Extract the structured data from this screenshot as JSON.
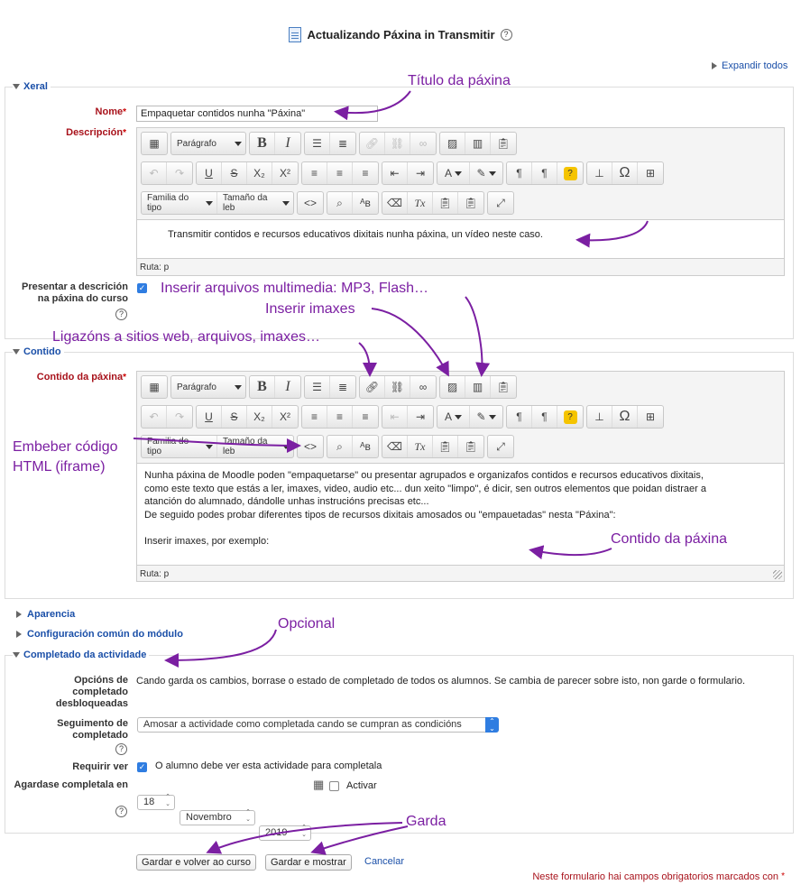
{
  "header": {
    "title": "Actualizando Páxina in Transmitir",
    "help": "?"
  },
  "expand_all": "Expandir todos",
  "xeral": {
    "legend": "Xeral",
    "name_label": "Nome",
    "name_value": "Empaquetar contidos nunha \"Páxina\"",
    "description_label": "Descripción",
    "description_text": "Transmitir contidos e recursos educativos dixitais nunha páxina, un vídeo neste caso.",
    "path": "Ruta: p",
    "show_desc_label": "Presentar a descrición na páxina do curso"
  },
  "toolbar": {
    "paragraph": "Parágrafo",
    "font_family": "Familia do tipo",
    "font_size": "Tamaño da leb",
    "bold": "B",
    "italic": "I",
    "sub": "X₂",
    "sup": "X²",
    "omega": "Ω",
    "textcolor": "A",
    "clear": "Tx",
    "source": "<>",
    "help": "?"
  },
  "contido": {
    "legend": "Contido",
    "label": "Contido da páxina",
    "lines": [
      "Nunha páxina de Moodle poden \"empaquetarse\" ou presentar agrupados e organizafos contidos e recursos educativos dixitais,",
      "como este texto que estás a ler, imaxes, video, audio etc... dun xeito \"limpo\", é dicir, sen outros elementos que poidan distraer a",
      "atanción do alumnado, dándolle unhas instrucións precisas etc...",
      "De seguido podes probar diferentes tipos de recursos dixitais amosados ou \"empauetadas\" nesta \"Páxina\":",
      "",
      "Inserir imaxes, por exemplo:"
    ],
    "path": "Ruta: p"
  },
  "sections": {
    "aparencia": "Aparencia",
    "config": "Configuración común do módulo",
    "completado": "Completado da actividade"
  },
  "completion": {
    "unlocked_label": "Opcións de completado desbloqueadas",
    "unlocked_text": "Cando garda os cambios, borrase o estado de completado de todos os alumnos. Se cambia de parecer sobre isto, non garde o formulario.",
    "tracking_label": "Seguimento de completado",
    "tracking_value": "Amosar a actividade como completada cando se cumpran as condicións",
    "require_view_label": "Requirir ver",
    "require_view_text": "O alumno debe ver esta actividade para completala",
    "expected_label": "Agardase completala en",
    "day": "18",
    "month": "Novembro",
    "year": "2019",
    "enable": "Activar"
  },
  "buttons": {
    "save_return": "Gardar e volver ao curso",
    "save_show": "Gardar e mostrar",
    "cancel": "Cancelar"
  },
  "required_note": "Neste formulario hai campos obrigatorios marcados con",
  "annotations": {
    "title": "Título da páxina",
    "multimedia": "Inserir arquivos multimedia: MP3, Flash…",
    "images": "Inserir imaxes",
    "links": "Ligazóns a sitios web, arquivos, imaxes…",
    "embed_1": "Embeber código",
    "embed_2": "HTML (iframe)",
    "content": "Contido da páxina",
    "optional": "Opcional",
    "save": "Garda"
  },
  "colors": {
    "annotation": "#7b1fa2",
    "link": "#1a4fa8",
    "required": "#a8121b",
    "checkbox": "#2f7de1"
  }
}
